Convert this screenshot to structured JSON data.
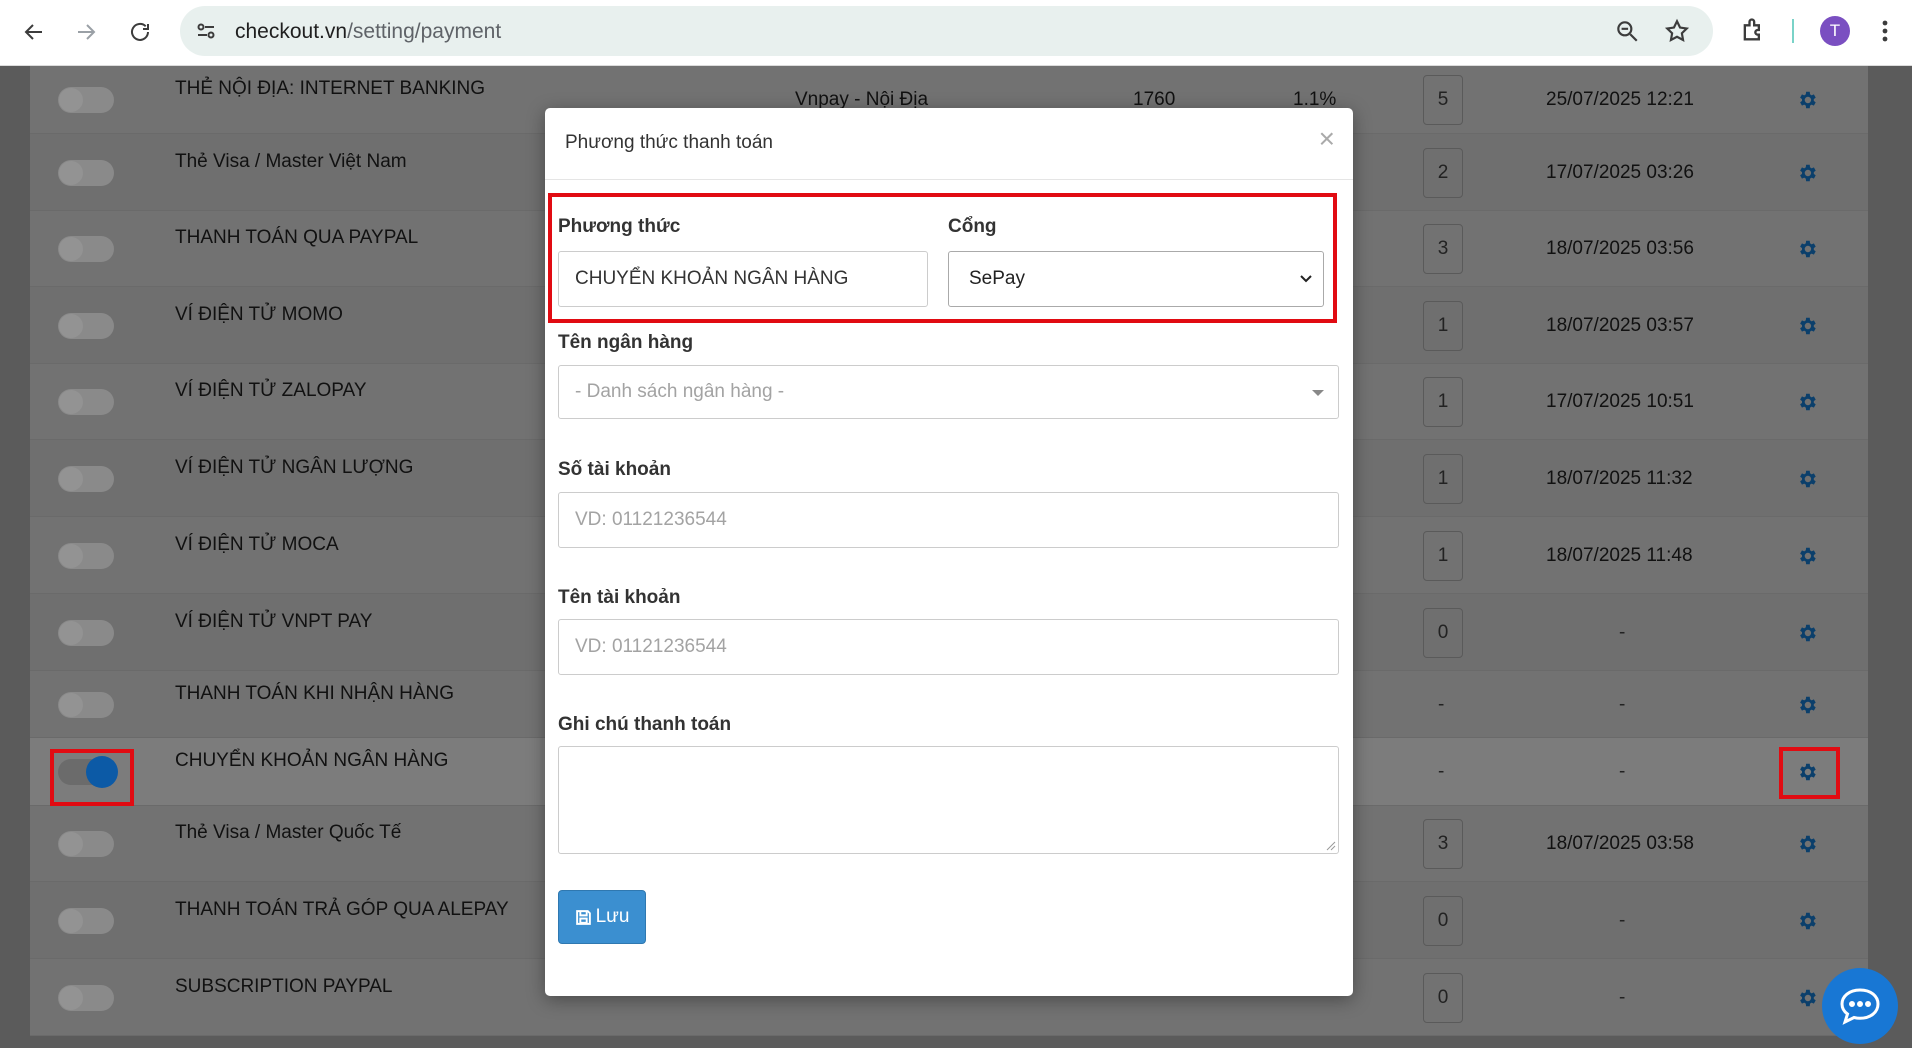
{
  "browser": {
    "url_host": "checkout.vn",
    "url_path": "/setting/payment",
    "profile_initial": "T"
  },
  "table": {
    "rows": [
      {
        "name": "THẺ NỘI ĐỊA: INTERNET BANKING",
        "provider": "Vnpay - Nội Địa",
        "number": "1760",
        "percent": "1.1%",
        "count": "5",
        "date": "25/07/2025 12:21",
        "enabled": false
      },
      {
        "name": "Thẻ Visa / Master Việt Nam",
        "provider": "",
        "number": "",
        "percent": "",
        "count": "2",
        "date": "17/07/2025 03:26",
        "enabled": false
      },
      {
        "name": "THANH TOÁN QUA PAYPAL",
        "provider": "",
        "number": "",
        "percent": "",
        "count": "3",
        "date": "18/07/2025 03:56",
        "enabled": false
      },
      {
        "name": "VÍ ĐIỆN TỬ MOMO",
        "provider": "",
        "number": "",
        "percent": "",
        "count": "1",
        "date": "18/07/2025 03:57",
        "enabled": false
      },
      {
        "name": "VÍ ĐIỆN TỬ ZALOPAY",
        "provider": "",
        "number": "",
        "percent": "",
        "count": "1",
        "date": "17/07/2025 10:51",
        "enabled": false
      },
      {
        "name": "VÍ ĐIỆN TỬ NGÂN LƯỢNG",
        "provider": "",
        "number": "",
        "percent": "",
        "count": "1",
        "date": "18/07/2025 11:32",
        "enabled": false
      },
      {
        "name": "VÍ ĐIỆN TỬ MOCA",
        "provider": "",
        "number": "",
        "percent": "",
        "count": "1",
        "date": "18/07/2025 11:48",
        "enabled": false
      },
      {
        "name": "VÍ ĐIỆN TỬ VNPT PAY",
        "provider": "",
        "number": "",
        "percent": "",
        "count": "0",
        "date": "-",
        "enabled": false
      },
      {
        "name": "THANH TOÁN KHI NHẬN HÀNG",
        "provider": "",
        "number": "",
        "percent": "",
        "count": "-",
        "date": "-",
        "enabled": false
      },
      {
        "name": "CHUYỂN KHOẢN NGÂN HÀNG",
        "provider": "",
        "number": "",
        "percent": "",
        "count": "-",
        "date": "-",
        "enabled": true
      },
      {
        "name": "Thẻ Visa / Master Quốc Tế",
        "provider": "",
        "number": "",
        "percent": "",
        "count": "3",
        "date": "18/07/2025 03:58",
        "enabled": false
      },
      {
        "name": "THANH TOÁN TRẢ GÓP QUA ALEPAY",
        "provider": "",
        "number": "",
        "percent": "",
        "count": "0",
        "date": "-",
        "enabled": false
      },
      {
        "name": "SUBSCRIPTION PAYPAL",
        "provider": "",
        "number": "",
        "percent": "",
        "count": "0",
        "date": "-",
        "enabled": false
      }
    ]
  },
  "modal": {
    "title": "Phương thức thanh toán",
    "close_glyph": "×",
    "method_label": "Phương thức",
    "method_value": "CHUYỂN KHOẢN NGÂN HÀNG",
    "gateway_label": "Cổng",
    "gateway_value": "SePay",
    "bank_label": "Tên ngân hàng",
    "bank_placeholder": "- Danh sách ngân hàng -",
    "account_number_label": "Số tài khoản",
    "account_number_placeholder": "VD: 01121236544",
    "account_name_label": "Tên tài khoản",
    "account_name_placeholder": "VD: 01121236544",
    "note_label": "Ghi chú thanh toán",
    "save_label": "Lưu"
  },
  "colors": {
    "accent": "#3b8fd0",
    "highlight": "#e10b12",
    "toggle_on": "#0c5aa6"
  }
}
